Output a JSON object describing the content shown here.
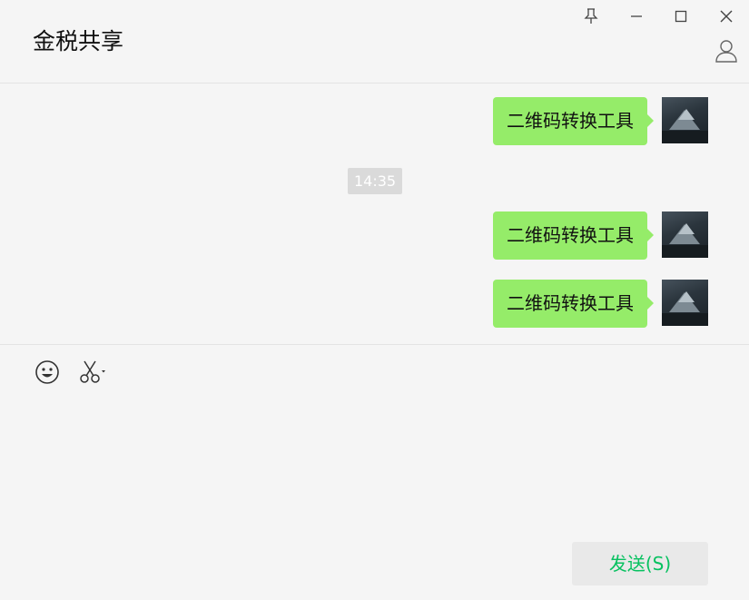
{
  "window": {
    "controls": [
      "pin-icon",
      "minimize-icon",
      "maximize-icon",
      "close-icon"
    ]
  },
  "header": {
    "title": "金税共享",
    "profile_icon": "profile-icon"
  },
  "messages": [
    {
      "text": "二维码转换工具",
      "sender": "me"
    },
    {
      "text": "二维码转换工具",
      "sender": "me"
    },
    {
      "text": "二维码转换工具",
      "sender": "me"
    }
  ],
  "timestamp": "14:35",
  "toolbar": {
    "emoji_icon": "emoji-icon",
    "screenshot_icon": "scissors-icon"
  },
  "send_button": {
    "label": "发送(S)"
  },
  "colors": {
    "bubble": "#95ec69",
    "send_text": "#07c160",
    "background": "#f5f5f5"
  }
}
